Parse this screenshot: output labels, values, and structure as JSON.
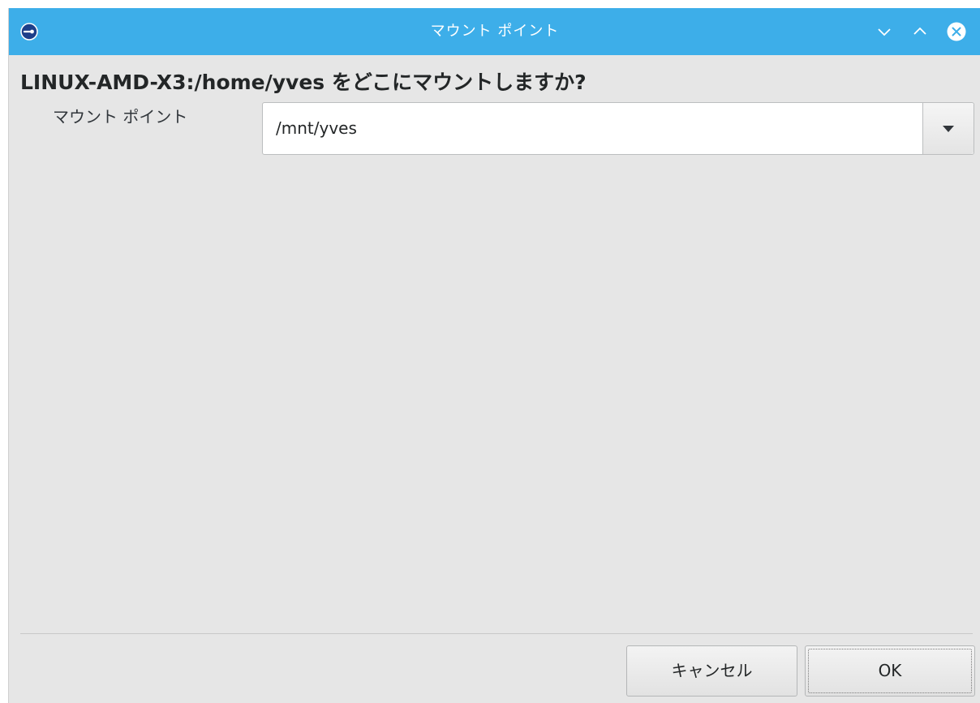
{
  "window": {
    "title": "マウント ポイント",
    "icons": {
      "app": "drive-mount-icon",
      "minimize": "chevron-down-icon",
      "maximize": "chevron-up-icon",
      "close": "close-circle-icon"
    },
    "colors": {
      "titlebar": "#3daee9",
      "background": "#e6e6e6"
    }
  },
  "dialog": {
    "question": "LINUX-AMD-X3:/home/yves をどこにマウントしますか?",
    "mount_point_label": "マウント ポイント",
    "mount_point_value": "/mnt/yves",
    "dropdown_icon": "triangle-down-icon"
  },
  "buttons": {
    "cancel": "キャンセル",
    "ok": "OK"
  }
}
